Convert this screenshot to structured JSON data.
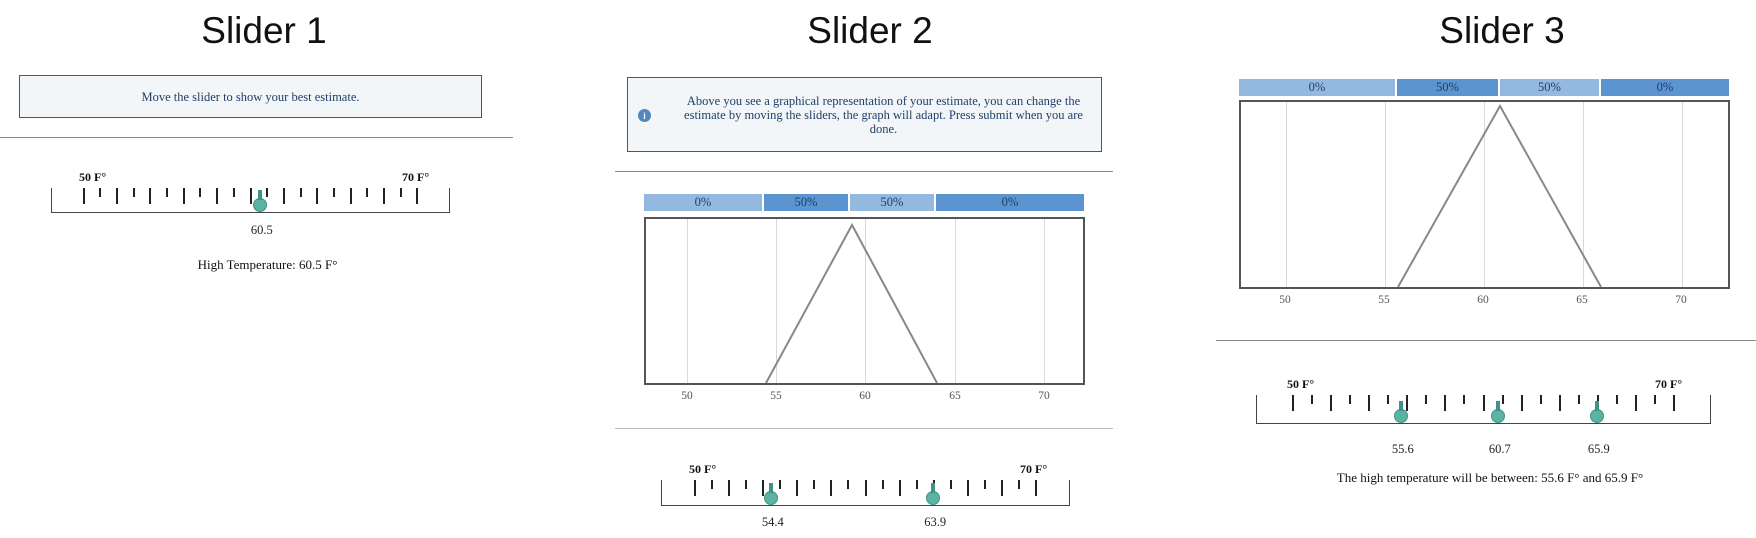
{
  "slider1": {
    "title": "Slider 1",
    "message": "Move the slider to show your best estimate.",
    "min_label": "50 F°",
    "max_label": "70 F°",
    "value": 60.5,
    "value_label": "60.5",
    "readout": "High Temperature: 60.5 F°"
  },
  "slider2": {
    "title": "Slider 2",
    "message": "Above you see a graphical representation of your estimate, you can change the estimate by moving the sliders, the graph will adapt. Press submit when you are done.",
    "info_icon": "i",
    "percent_bar": [
      "0%",
      "50%",
      "50%",
      "0%"
    ],
    "x_ticks": [
      "50",
      "55",
      "60",
      "65",
      "70"
    ],
    "min_label": "50 F°",
    "max_label": "70 F°",
    "values": [
      54.4,
      63.9
    ],
    "value_labels": [
      "54.4",
      "63.9"
    ]
  },
  "slider3": {
    "title": "Slider 3",
    "percent_bar": [
      "0%",
      "50%",
      "50%",
      "0%"
    ],
    "x_ticks": [
      "50",
      "55",
      "60",
      "65",
      "70"
    ],
    "min_label": "50 F°",
    "max_label": "70 F°",
    "values": [
      55.6,
      60.7,
      65.9
    ],
    "value_labels": [
      "55.6",
      "60.7",
      "65.9"
    ],
    "readout": "The high temperature will be between: 55.6 F° and 65.9 F°"
  },
  "colors": {
    "handle": "#5bb3a4",
    "bar_light": "#93b9e1",
    "bar_dark": "#5c94d0",
    "message_border": "#2f5f8c"
  }
}
